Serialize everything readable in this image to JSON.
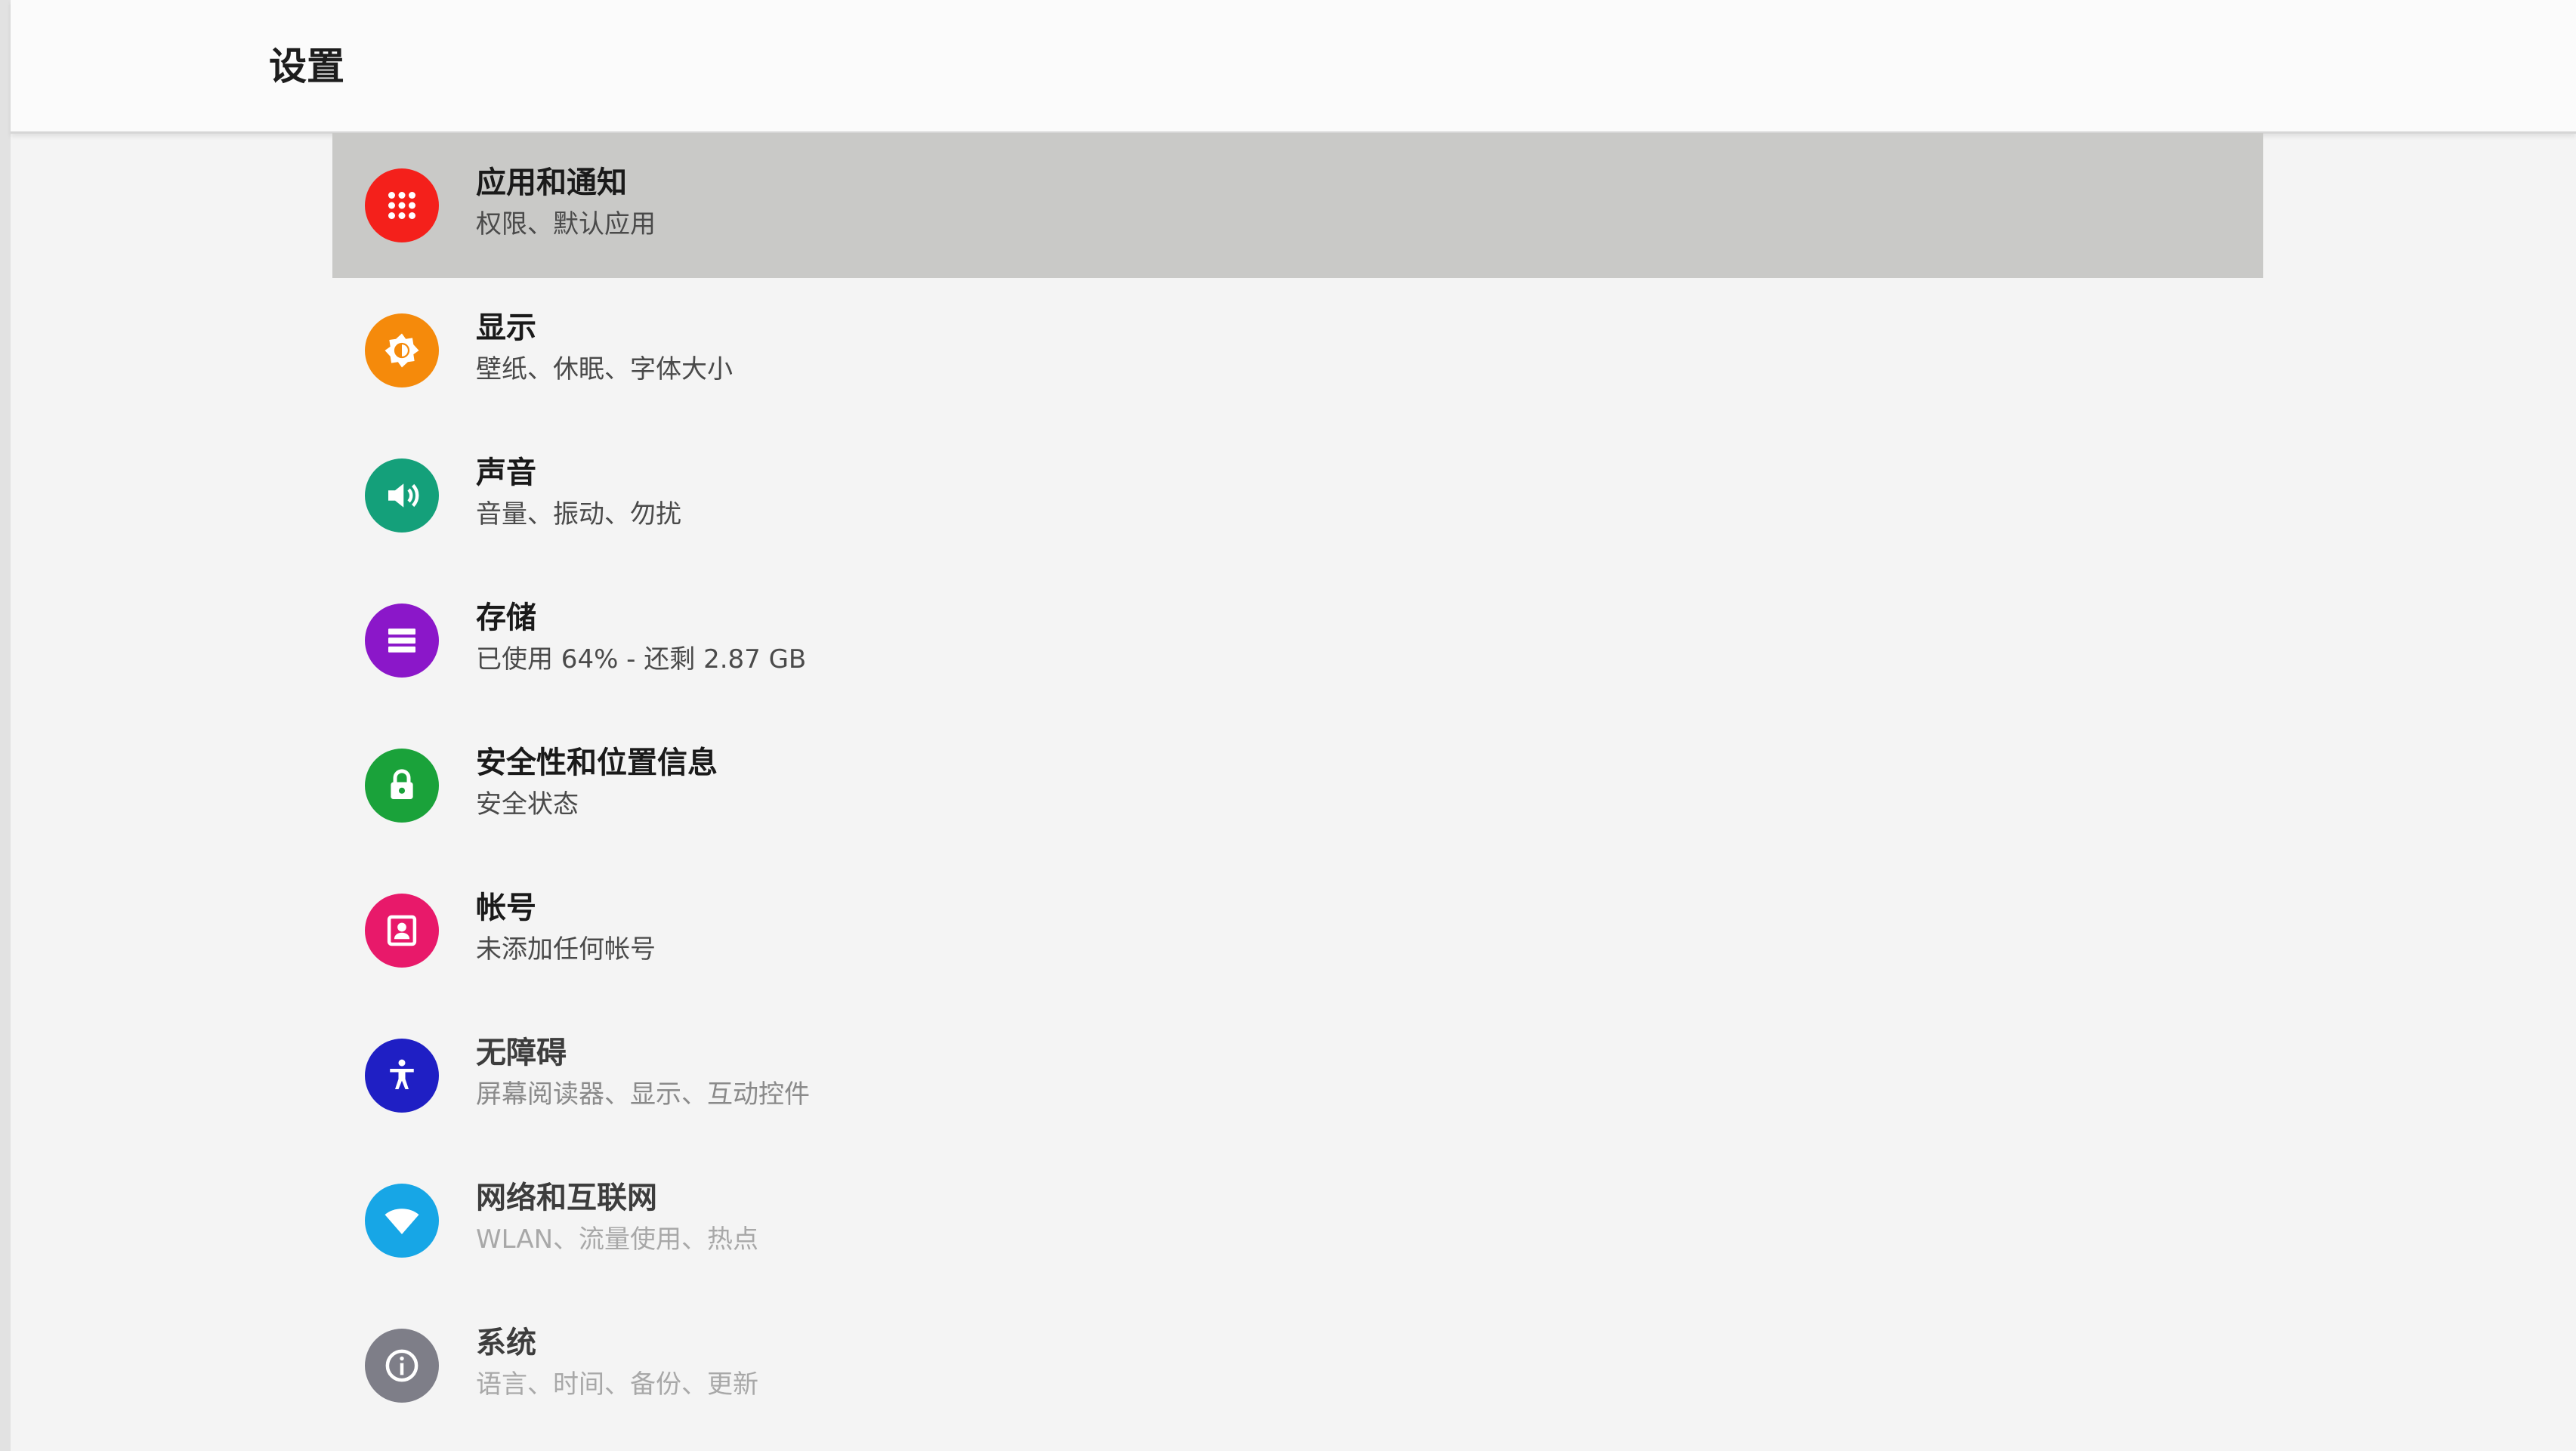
{
  "app_bar": {
    "title": "设置"
  },
  "items": [
    {
      "title": "应用和通知",
      "subtitle": "权限、默认应用",
      "icon": "apps-grid-icon",
      "color": "#f4201b",
      "selected": true
    },
    {
      "title": "显示",
      "subtitle": "壁纸、休眠、字体大小",
      "icon": "brightness-icon",
      "color": "#f58a0b"
    },
    {
      "title": "声音",
      "subtitle": "音量、振动、勿扰",
      "icon": "volume-icon",
      "color": "#14a07a"
    },
    {
      "title": "存储",
      "subtitle": "已使用 64% - 还剩 2.87 GB",
      "icon": "storage-icon",
      "color": "#8b17c9"
    },
    {
      "title": "安全性和位置信息",
      "subtitle": "安全状态",
      "icon": "lock-icon",
      "color": "#1aa23a"
    },
    {
      "title": "帐号",
      "subtitle": "未添加任何帐号",
      "icon": "account-icon",
      "color": "#e8196a"
    },
    {
      "title": "无障碍",
      "subtitle": "屏幕阅读器、显示、互动控件",
      "icon": "accessibility-icon",
      "color": "#1f1fc4"
    },
    {
      "title": "网络和互联网",
      "subtitle": "WLAN、流量使用、热点",
      "icon": "wifi-icon",
      "color": "#17a6e6"
    },
    {
      "title": "系统",
      "subtitle": "语言、时间、备份、更新",
      "icon": "info-icon",
      "color": "#7e7e88"
    }
  ]
}
